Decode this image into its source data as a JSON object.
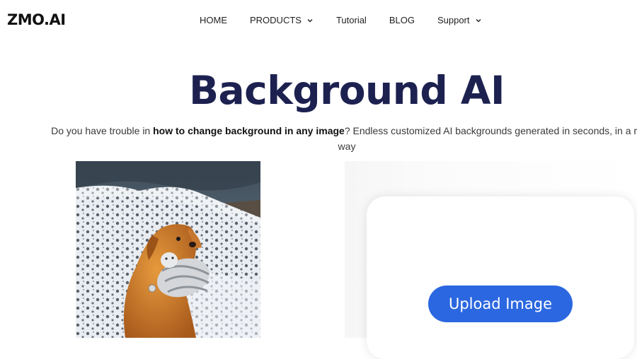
{
  "header": {
    "logo_text": "ZMO.AI",
    "nav": [
      {
        "label": "HOME",
        "has_dropdown": false
      },
      {
        "label": "PRODUCTS",
        "has_dropdown": true
      },
      {
        "label": "Tutorial",
        "has_dropdown": false
      },
      {
        "label": "BLOG",
        "has_dropdown": false
      },
      {
        "label": "Support",
        "has_dropdown": true
      }
    ]
  },
  "hero": {
    "title": "Background AI",
    "subtitle_prefix": "Do you have trouble in ",
    "subtitle_bold": "how to change background in any image",
    "subtitle_suffix": "? Endless customized AI backgrounds generated in seconds, in a re",
    "subtitle_line2": "way"
  },
  "upload": {
    "button_label": "Upload Image"
  },
  "colors": {
    "title": "#1c2150",
    "button": "#2b67e0"
  },
  "icons": {
    "nav_dropdown": "chevron-down-icon"
  }
}
